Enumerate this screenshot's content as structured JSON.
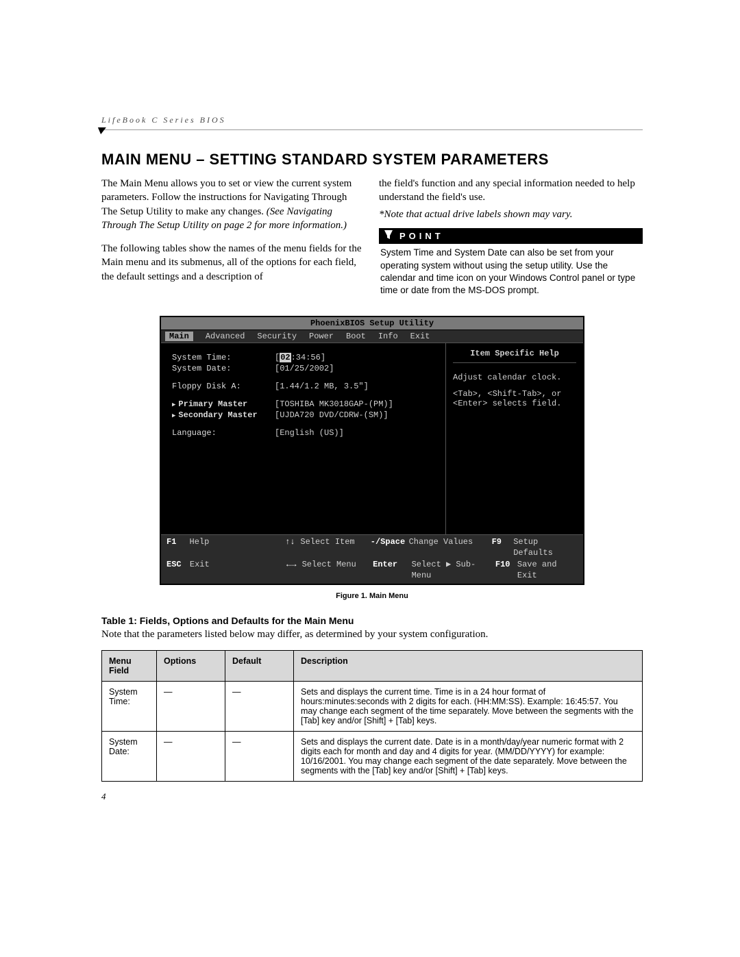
{
  "header": {
    "running_head": "LifeBook C Series BIOS"
  },
  "title": "MAIN MENU – SETTING STANDARD SYSTEM PARAMETERS",
  "intro": {
    "p1_a": "The Main Menu allows you to set or view the current system parameters. Follow the instructions for Navigating Through The Setup Utility to make any changes. ",
    "p1_b": "(See Navigating Through The Setup Utility on page 2 for more information.)",
    "p2": "The following tables show the names of the menu fields for the Main menu and its submenus, all of the options for each field, the default settings and a description of",
    "p3": "the field's function and any special information needed to help understand the field's use.",
    "note": "*Note that actual drive labels shown may vary."
  },
  "point": {
    "label": "POINT",
    "text": "System Time and System Date can also be set from your operating system without using the setup utility. Use the calendar and time icon on your Windows Control panel or type time or date from the MS-DOS prompt."
  },
  "bios": {
    "title": "PhoenixBIOS Setup Utility",
    "tabs": [
      "Main",
      "Advanced",
      "Security",
      "Power",
      "Boot",
      "Info",
      "Exit"
    ],
    "selected_tab": "Main",
    "fields": {
      "system_time_label": "System Time:",
      "system_time_hh": "02",
      "system_time_rest": ":34:56]",
      "system_date_label": "System Date:",
      "system_date_value": "[01/25/2002]",
      "floppy_label": "Floppy Disk A:",
      "floppy_value": "[1.44/1.2 MB, 3.5\"]",
      "primary_label": "Primary Master",
      "primary_value": "[TOSHIBA MK3018GAP-(PM)]",
      "secondary_label": "Secondary Master",
      "secondary_value": "[UJDA720 DVD/CDRW-(SM)]",
      "language_label": "Language:",
      "language_value": "[English (US)]"
    },
    "help": {
      "title": "Item Specific Help",
      "line1": "Adjust calendar clock.",
      "line2": "<Tab>, <Shift-Tab>, or",
      "line3": "<Enter> selects field."
    },
    "footer": {
      "f1": "F1",
      "f1_label": "Help",
      "ud": "↑↓",
      "ud_label": "Select Item",
      "sp": "-/Space",
      "sp_label": "Change Values",
      "f9": "F9",
      "f9_label": "Setup Defaults",
      "esc": "ESC",
      "esc_label": "Exit",
      "lr": "←→",
      "lr_label": "Select Menu",
      "ent": "Enter",
      "ent_label": "Select ▶ Sub-Menu",
      "f10": "F10",
      "f10_label": "Save and Exit"
    }
  },
  "caption": "Figure 1.   Main Menu",
  "table": {
    "title": "Table 1: Fields, Options and Defaults for the Main Menu",
    "note": "Note that the parameters listed below may differ, as determined by your system configuration.",
    "headers": [
      "Menu Field",
      "Options",
      "Default",
      "Description"
    ],
    "rows": [
      {
        "field": "System Time:",
        "options": "—",
        "default": "—",
        "desc": "Sets and displays the current time. Time is in a 24 hour format of hours:minutes:seconds with 2 digits for each. (HH:MM:SS). Example: 16:45:57. You may change each segment of the time separately. Move between the segments with the [Tab] key and/or [Shift] + [Tab] keys."
      },
      {
        "field": "System Date:",
        "options": "—",
        "default": "—",
        "desc": "Sets and displays the current date. Date is in a month/day/year numeric format with 2 digits each for month and day and 4 digits for year. (MM/DD/YYYY) for example: 10/16/2001. You may change each segment of the date separately. Move between the segments with the [Tab] key and/or [Shift] + [Tab] keys."
      }
    ]
  },
  "page_number": "4"
}
